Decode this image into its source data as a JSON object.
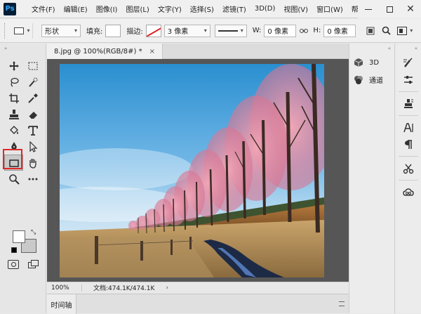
{
  "app": {
    "logo": "Ps"
  },
  "menu": [
    "文件(F)",
    "编辑(E)",
    "图像(I)",
    "图层(L)",
    "文字(Y)",
    "选择(S)",
    "滤镜(T)",
    "3D(D)",
    "视图(V)",
    "窗口(W)",
    "帮助"
  ],
  "options": {
    "mode": "形状",
    "fill_label": "填充:",
    "stroke_label": "描边:",
    "stroke_width": "3 像素",
    "w_label": "W:",
    "w_value": "0 像素",
    "h_label": "H:",
    "h_value": "0 像素",
    "stroke_color": "#e02020"
  },
  "document": {
    "tab_title": "8.jpg @ 100%(RGB/8#) *",
    "close": "×"
  },
  "status": {
    "zoom": "100%",
    "doc_info": "文档:474.1K/474.1K",
    "arrow": "›"
  },
  "timeline": {
    "label": "时间轴"
  },
  "panels": [
    {
      "label": "3D",
      "icon": "cube-icon"
    },
    {
      "label": "通道",
      "icon": "channels-icon"
    }
  ],
  "tools_highlight_color": "#e02828"
}
